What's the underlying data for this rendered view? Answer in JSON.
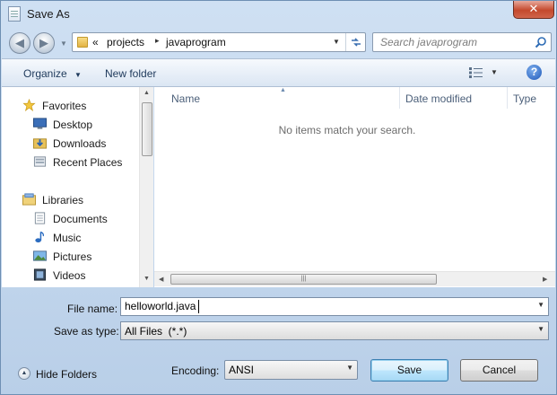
{
  "window": {
    "title": "Save As",
    "close_label": "✕"
  },
  "address": {
    "overflow_glyph": "«",
    "crumbs": [
      "projects",
      "javaprogram"
    ],
    "separator": "▸"
  },
  "search": {
    "placeholder": "Search javaprogram"
  },
  "toolbar": {
    "organize_label": "Organize",
    "new_folder_label": "New folder",
    "help_label": "?"
  },
  "nav_pane": {
    "items": [
      {
        "label": "Favorites",
        "icon": "star-icon",
        "group": true
      },
      {
        "label": "Desktop",
        "icon": "desktop-icon"
      },
      {
        "label": "Downloads",
        "icon": "downloads-icon"
      },
      {
        "label": "Recent Places",
        "icon": "recent-places-icon"
      },
      {
        "label": "Libraries",
        "icon": "libraries-icon",
        "group": true
      },
      {
        "label": "Documents",
        "icon": "documents-icon"
      },
      {
        "label": "Music",
        "icon": "music-icon"
      },
      {
        "label": "Pictures",
        "icon": "pictures-icon"
      },
      {
        "label": "Videos",
        "icon": "videos-icon"
      }
    ]
  },
  "file_list": {
    "columns": [
      "Name",
      "Date modified",
      "Type"
    ],
    "empty_message": "No items match your search."
  },
  "form": {
    "file_name_label": "File name:",
    "file_name_value": "helloworld.java",
    "save_type_label": "Save as type:",
    "save_type_value": "All Files  (*.*)"
  },
  "footer": {
    "hide_folders_label": "Hide Folders",
    "encoding_label": "Encoding:",
    "encoding_value": "ANSI",
    "save_label": "Save",
    "cancel_label": "Cancel"
  },
  "colors": {
    "accent": "#3c7fb1",
    "toolbar_text": "#1e395b",
    "column_header_text": "#4c607a"
  }
}
